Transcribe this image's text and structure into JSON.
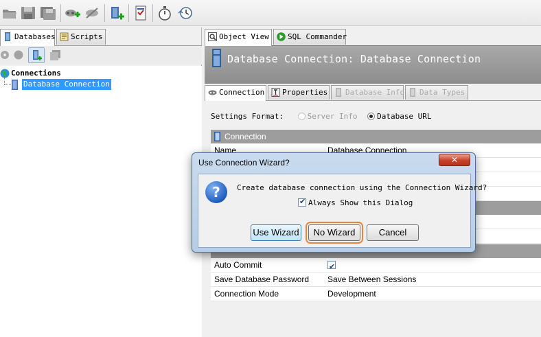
{
  "toolbar": {
    "icons": [
      "open-icon",
      "save-icon",
      "save-all-icon",
      "new-connection-icon",
      "disconnect-icon",
      "new-database-icon",
      "sql-script-icon",
      "stopwatch-icon",
      "history-icon"
    ]
  },
  "left_panel": {
    "tabs": [
      {
        "label": "Databases",
        "active": true
      },
      {
        "label": "Scripts",
        "active": false
      }
    ],
    "tree": {
      "root_label": "Connections",
      "children": [
        {
          "label": "Database Connection",
          "selected": true
        }
      ]
    }
  },
  "right_panel": {
    "tabs": [
      {
        "label": "Object View",
        "active": true
      },
      {
        "label": "SQL Commander",
        "active": false
      }
    ],
    "header_title": "Database Connection: Database Connection",
    "inner_tabs": [
      {
        "label": "Connection",
        "active": true,
        "disabled": false
      },
      {
        "label": "Properties",
        "active": false,
        "disabled": false
      },
      {
        "label": "Database Info",
        "active": false,
        "disabled": true
      },
      {
        "label": "Data Types",
        "active": false,
        "disabled": true
      }
    ],
    "settings_format": {
      "label": "Settings Format:",
      "options": [
        {
          "label": "Server Info",
          "selected": false
        },
        {
          "label": "Database URL",
          "selected": true
        }
      ]
    },
    "section_connection": "Connection",
    "name_row": {
      "key": "Name",
      "value": "Database Connection"
    },
    "bottom_rows": [
      {
        "key": "Auto Commit",
        "value": "",
        "checkbox": true,
        "checked": true
      },
      {
        "key": "Save Database Password",
        "value": "Save Between Sessions"
      },
      {
        "key": "Connection Mode",
        "value": "Development"
      }
    ]
  },
  "dialog": {
    "title": "Use Connection Wizard?",
    "close_label": "✕",
    "message": "Create database connection using the Connection Wizard?",
    "checkbox_label": "Always Show this Dialog",
    "checkbox_checked": true,
    "buttons": {
      "use_wizard": "Use Wizard",
      "no_wizard": "No Wizard",
      "cancel": "Cancel"
    }
  },
  "colors": {
    "selection": "#3399ff",
    "header_band": "#999999",
    "highlight_outline": "#e8853a",
    "dialog_frame": "#b7cde6"
  }
}
